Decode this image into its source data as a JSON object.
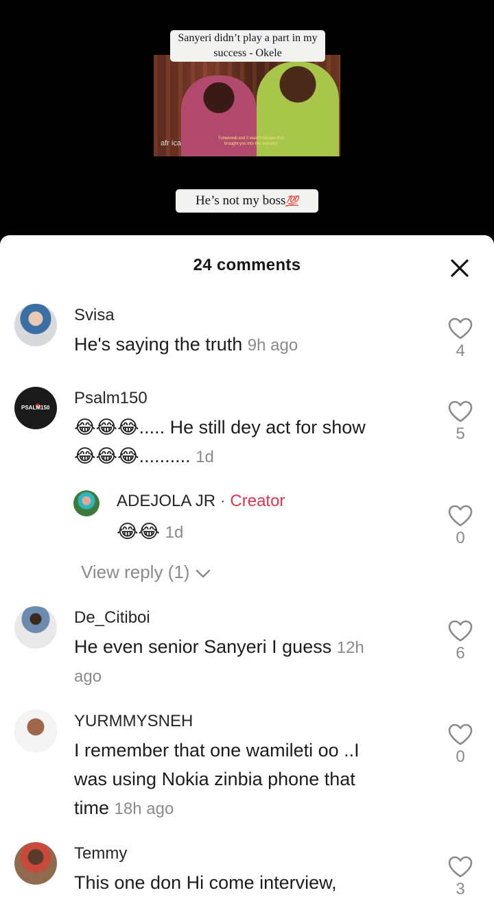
{
  "video": {
    "caption_top": "Sanyeri didn’t play a part in my success - Okele",
    "thumb_logo": "afr ica",
    "thumb_subtitle": "Tuhweredi and it wasn't Sanyeri that brought you into this industry.",
    "caption_bottom": "He’s not my boss",
    "caption_bottom_emoji": "💯"
  },
  "sheet": {
    "title": "24 comments",
    "close_icon": "close-icon"
  },
  "comments": [
    {
      "username": "Svisa",
      "text": "He's saying the truth",
      "time": "9h ago",
      "likes": "4"
    },
    {
      "username": "Psalm150",
      "text_line1": "😂😂😂..... He still dey act for show",
      "text_line2": "😂😂😂..........",
      "time": "1d",
      "likes": "5",
      "avatar_label": "PSALM150"
    },
    {
      "username": "ADEJOLA JR",
      "separator": "·",
      "badge": "Creator",
      "text": "😂😂",
      "time": "1d",
      "likes": "0",
      "is_reply": true
    },
    {
      "view_reply": "View reply (1)"
    },
    {
      "username": "De_Citiboi",
      "text": "He even senior Sanyeri I guess",
      "time_a": "12h",
      "time_b": "ago",
      "likes": "6"
    },
    {
      "username": "YURMMYSNEH",
      "text_line1": "I remember that one wamileti oo ..I",
      "text_line2": "was using Nokia zinbia phone that",
      "text_line3": "time",
      "time": "18h ago",
      "likes": "0"
    },
    {
      "username": "Temmy",
      "text": "This one don Hi come interview,",
      "likes": "3"
    }
  ],
  "colors": {
    "creator_badge": "#e0354f",
    "meta_gray": "#8a8a8a",
    "sheet_bg": "#ffffff",
    "video_bg": "#000000"
  }
}
